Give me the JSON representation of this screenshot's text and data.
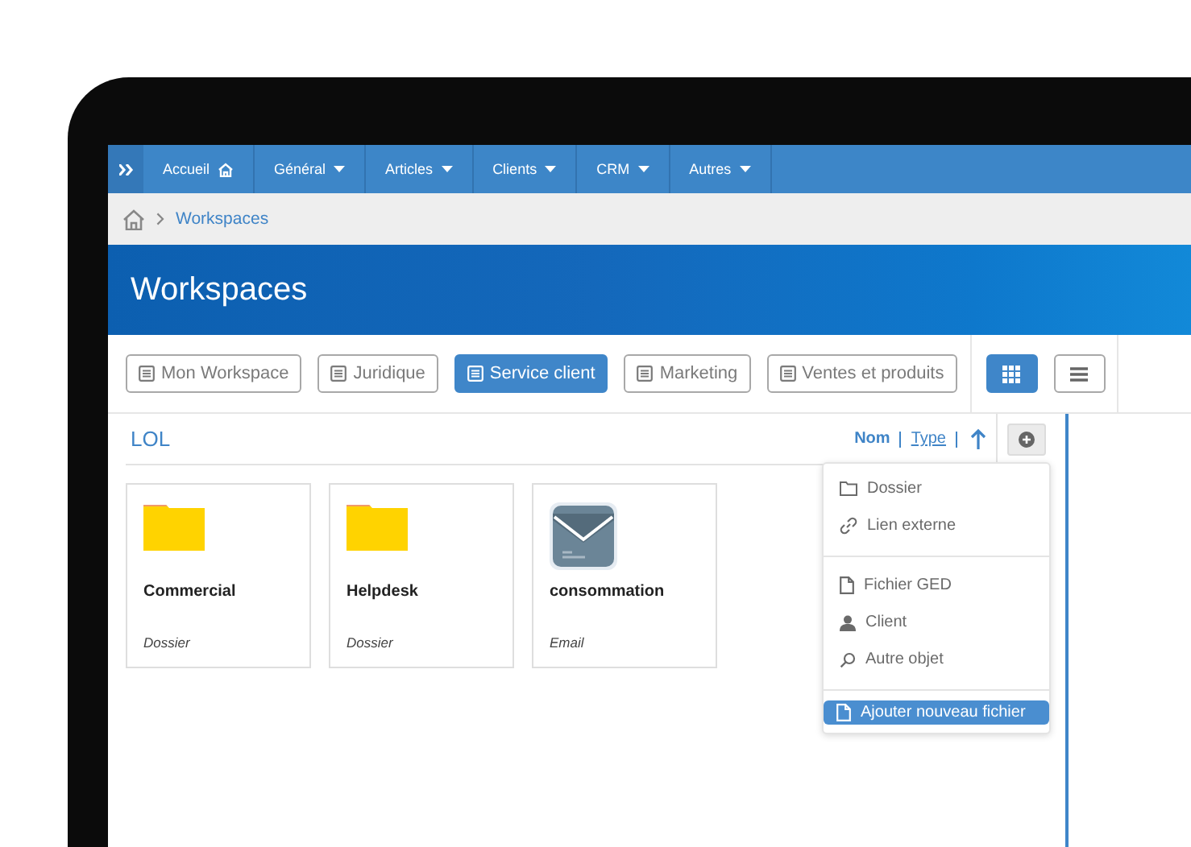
{
  "navbar": {
    "items": [
      {
        "label": "Accueil",
        "kind": "home"
      },
      {
        "label": "Général",
        "kind": "dropdown"
      },
      {
        "label": "Articles",
        "kind": "dropdown"
      },
      {
        "label": "Clients",
        "kind": "dropdown"
      },
      {
        "label": "CRM",
        "kind": "dropdown"
      },
      {
        "label": "Autres",
        "kind": "dropdown"
      }
    ]
  },
  "breadcrumb": {
    "items": [
      "Workspaces"
    ]
  },
  "banner": {
    "title": "Workspaces"
  },
  "workspace_tabs": [
    {
      "label": "Mon Workspace",
      "selected": false
    },
    {
      "label": "Juridique",
      "selected": false
    },
    {
      "label": "Service client",
      "selected": true
    },
    {
      "label": "Marketing",
      "selected": false
    },
    {
      "label": "Ventes et produits",
      "selected": false
    }
  ],
  "view_modes": [
    {
      "kind": "grid",
      "selected": true
    },
    {
      "kind": "list",
      "selected": false
    }
  ],
  "section": {
    "title": "LOL"
  },
  "sort_options": [
    {
      "label": "Nom",
      "selected": true
    },
    {
      "label": "Type",
      "selected": false
    }
  ],
  "cards": [
    {
      "kind": "folder",
      "title": "Commercial",
      "type": "Dossier"
    },
    {
      "kind": "folder",
      "title": "Helpdesk",
      "type": "Dossier"
    },
    {
      "kind": "email",
      "title": "consommation",
      "type": "Email"
    }
  ],
  "add_menu": {
    "groups": [
      [
        {
          "label": "Dossier",
          "kind": "folder",
          "selected": false
        },
        {
          "label": "Lien externe",
          "kind": "link",
          "selected": false
        }
      ],
      [
        {
          "label": "Fichier GED",
          "kind": "file",
          "selected": false
        },
        {
          "label": "Client",
          "kind": "user",
          "selected": false
        },
        {
          "label": "Autre objet",
          "kind": "search",
          "selected": false
        }
      ],
      [
        {
          "label": "Ajouter nouveau fichier",
          "kind": "file",
          "selected": true
        }
      ]
    ]
  }
}
